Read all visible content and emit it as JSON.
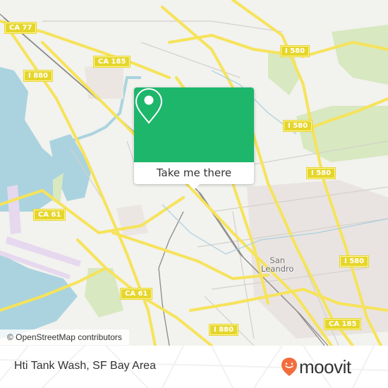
{
  "map": {
    "attribution": "© OpenStreetMap contributors",
    "city_label": {
      "line1": "San",
      "line2": "Leandro"
    },
    "road_shields": [
      {
        "id": "ca77",
        "label": "CA 77"
      },
      {
        "id": "ca185-top",
        "label": "CA 185"
      },
      {
        "id": "i880-top",
        "label": "I 880"
      },
      {
        "id": "i580-top",
        "label": "I 580"
      },
      {
        "id": "i580-mid",
        "label": "I 580"
      },
      {
        "id": "i580-right",
        "label": "I 580"
      },
      {
        "id": "i580-lower",
        "label": "I 580"
      },
      {
        "id": "ca61-left",
        "label": "CA 61"
      },
      {
        "id": "ca61-bottom",
        "label": "CA 61"
      },
      {
        "id": "i880-bottom",
        "label": "I 880"
      },
      {
        "id": "ca185-bottom",
        "label": "CA 185"
      }
    ],
    "colors": {
      "land": "#f2f2ee",
      "water": "#aad3df",
      "park": "#d8e8c0",
      "road": "#f6e35a",
      "residential": "#e8e2df"
    }
  },
  "popup": {
    "icon": "map-pin-icon",
    "button_label": "Take me there",
    "accent_color": "#1db66b"
  },
  "footer": {
    "place_name": "Hti Tank Wash, SF Bay Area",
    "brand": "moovit",
    "brand_color": "#f26d3d"
  }
}
